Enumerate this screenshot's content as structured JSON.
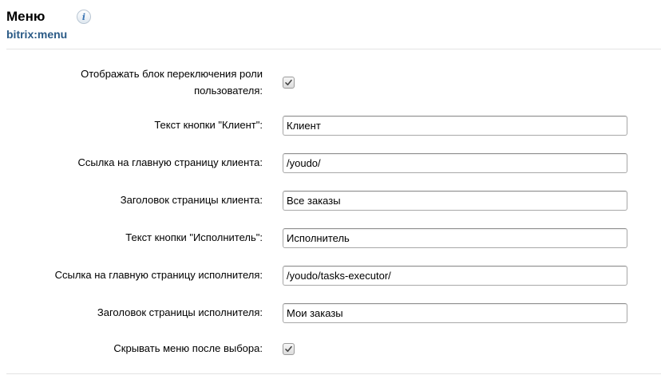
{
  "header": {
    "title": "Меню",
    "component_code": "bitrix:menu",
    "info_icon": "info-icon"
  },
  "fields": {
    "show_role_switch": {
      "label": "Отображать блок переключения роли пользователя:",
      "checked": true
    },
    "client_button_text": {
      "label": "Текст кнопки \"Клиент\":",
      "value": "Клиент"
    },
    "client_home_link": {
      "label": "Ссылка на главную страницу клиента:",
      "value": "/youdo/"
    },
    "client_page_title": {
      "label": "Заголовок страницы клиента:",
      "value": "Все заказы"
    },
    "executor_button_text": {
      "label": "Текст кнопки \"Исполнитель\":",
      "value": "Исполнитель"
    },
    "executor_home_link": {
      "label": "Ссылка на главную страницу исполнителя:",
      "value": "/youdo/tasks-executor/"
    },
    "executor_page_title": {
      "label": "Заголовок страницы исполнителя:",
      "value": "Мои заказы"
    },
    "hide_menu_after_select": {
      "label": "Скрывать меню после выбора:",
      "checked": true
    }
  },
  "colors": {
    "component_code": "#2a5a86",
    "info_icon": "#3b75b4",
    "divider": "#e3e3e3"
  }
}
